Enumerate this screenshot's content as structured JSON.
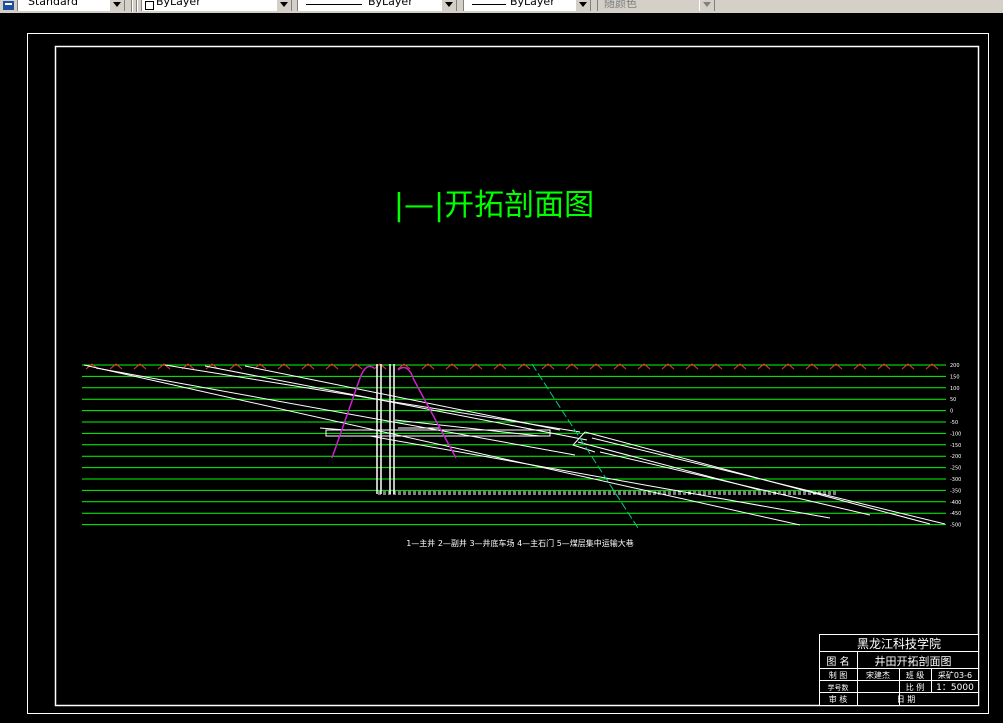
{
  "toolbar": {
    "text_style": "Standard",
    "layer_color": "ByLayer",
    "linetype": "ByLayer",
    "lineweight": "ByLayer",
    "plot_style": "随颜色"
  },
  "drawing": {
    "title": "|—|开拓剖面图",
    "legend": "1—主井 2—副井 3—井底车场 4—主石门 5—煤层集中运输大巷",
    "elevation_labels": [
      "200",
      "150",
      "100",
      "50",
      "0",
      "-50",
      "-100",
      "-150",
      "-200",
      "-250",
      "-300",
      "-350",
      "-400",
      "-450",
      "-500"
    ]
  },
  "title_block": {
    "school": "黑龙江科技学院",
    "name_label": "图 名",
    "name_value": "井田开拓剖面图",
    "drawn_label": "制 图",
    "drawn_value": "宋建杰",
    "class_label": "班 级",
    "class_value": "采矿03-6",
    "student_label": "学号数",
    "student_value": "",
    "scale_label": "比 例",
    "scale_value": "1：5000",
    "review_label": "审 核",
    "review_value": "",
    "date_label": "日 期",
    "date_value": ""
  },
  "colors": {
    "background": "#000000",
    "frame": "#ffffff",
    "elevation_lines": "#00ff00",
    "title_text": "#00ff00",
    "magenta_boundary": "#cc22cc",
    "fault_line": "#00cc88",
    "surface_marks": "#ff3333"
  }
}
